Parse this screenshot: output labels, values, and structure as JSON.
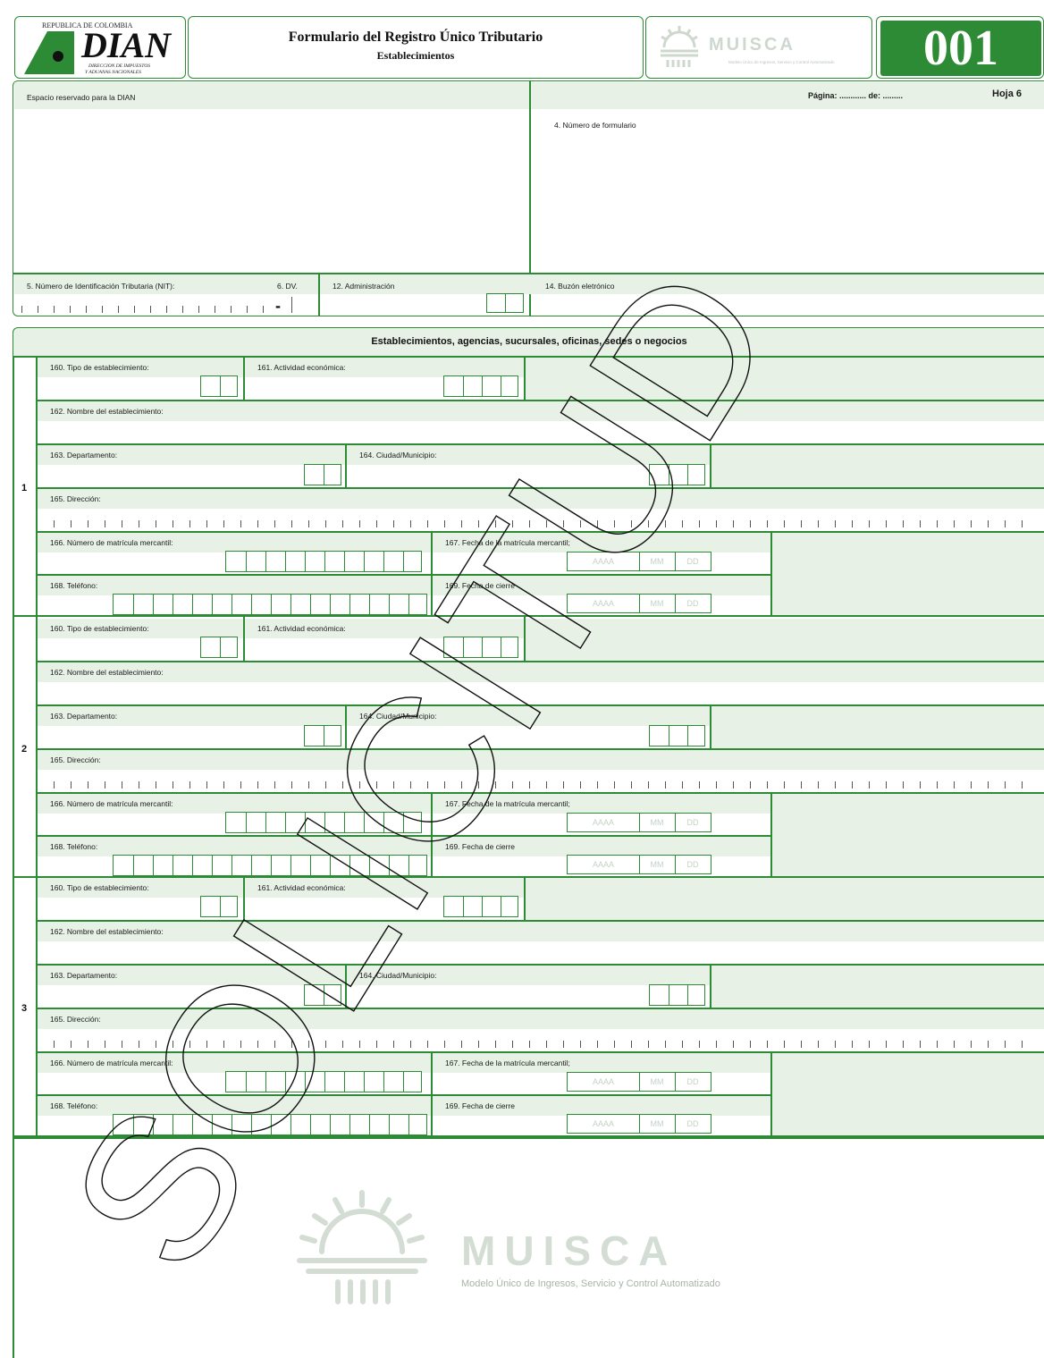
{
  "header": {
    "republica": "REPUBLICA DE COLOMBIA",
    "dian_logo": "DIAN",
    "dian_sub1": "DIRECCION DE IMPUESTOS",
    "dian_sub2": "Y ADUANAS NACIONALES",
    "title": "Formulario del Registro Único Tributario",
    "subtitle": "Establecimientos",
    "musica_small": "Modelo Único de Ingresos, Servicio y Control Automatizado",
    "form_number": "001"
  },
  "top": {
    "reserved": "Espacio reservado para la DIAN",
    "pagina": "Página: ............ de: .........",
    "hoja": "Hoja 6",
    "form_no_label": "4. Número de formulario",
    "nit_label": "5. Número de Identificación Tributaria (NIT):",
    "dv_label": "6. DV.",
    "admin_label": "12. Administración",
    "buzon_label": "14. Buzón eletrónico",
    "dash": "-"
  },
  "section_title": "Establecimientos, agencias, sucursales, oficinas, sedes o negocios",
  "labels": {
    "f160": "160. Tipo de establecimiento:",
    "f161": "161. Actividad económica:",
    "f162": "162. Nombre del establecimiento:",
    "f163": "163. Departamento:",
    "f164": "164. Ciudad/Municipio:",
    "f165": "165. Dirección:",
    "f166": "166. Número de matrícula mercantil:",
    "f167": "167. Fecha de la matrícula mercantil;",
    "f168": "168. Teléfono:",
    "f169": "169. Fecha de cierre",
    "aaaa": "AAAA",
    "mm": "MM",
    "dd": "DD"
  },
  "blocks": [
    {
      "number": "1"
    },
    {
      "number": "2"
    },
    {
      "number": "3"
    }
  ],
  "watermark": "SOLICITUD",
  "footer_logo": {
    "name": "MUISCA",
    "tagline": "Modelo Único de Ingresos, Servicio y Control Automatizado"
  },
  "colors": {
    "green": "#2e8b35",
    "band": "#e7f1e6"
  }
}
